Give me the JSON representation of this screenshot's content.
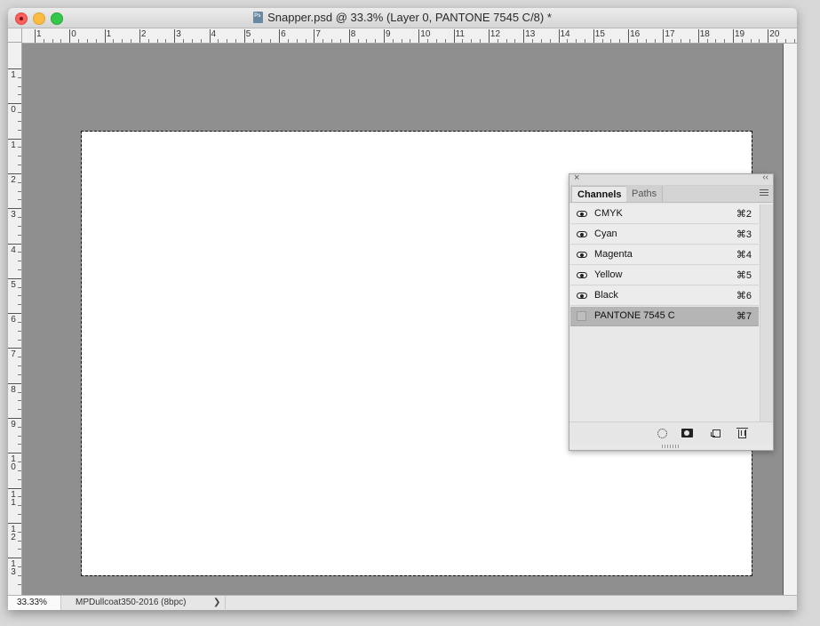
{
  "window": {
    "title": "Snapper.psd @ 33.3% (Layer 0, PANTONE 7545 C/8) *",
    "doc_icon": "photoshop-doc-icon"
  },
  "rulers": {
    "horizontal": [
      "1",
      "0",
      "1",
      "2",
      "3",
      "4",
      "5",
      "6",
      "7",
      "8",
      "9",
      "10",
      "11",
      "12",
      "13",
      "14",
      "15",
      "16",
      "17",
      "18",
      "19",
      "20"
    ],
    "vertical": [
      "1",
      "0",
      "1",
      "2",
      "3",
      "4",
      "5",
      "6",
      "7",
      "8",
      "9",
      "10",
      "11",
      "12",
      "13"
    ]
  },
  "status": {
    "zoom": "33.33%",
    "profile": "MPDullcoat350-2016 (8bpc)",
    "arrow": "❯"
  },
  "panel": {
    "close_glyph": "×",
    "collapse_glyph": "‹‹",
    "tabs": [
      {
        "label": "Channels",
        "active": true
      },
      {
        "label": "Paths",
        "active": false
      }
    ],
    "channels": [
      {
        "name": "CMYK",
        "shortcut": "⌘2",
        "visible": true,
        "selected": false
      },
      {
        "name": "Cyan",
        "shortcut": "⌘3",
        "visible": true,
        "selected": false
      },
      {
        "name": "Magenta",
        "shortcut": "⌘4",
        "visible": true,
        "selected": false
      },
      {
        "name": "Yellow",
        "shortcut": "⌘5",
        "visible": true,
        "selected": false
      },
      {
        "name": "Black",
        "shortcut": "⌘6",
        "visible": true,
        "selected": false
      },
      {
        "name": "PANTONE 7545 C",
        "shortcut": "⌘7",
        "visible": false,
        "selected": true
      }
    ],
    "footer_icons": [
      "load-selection-icon",
      "save-selection-mask-icon",
      "new-channel-icon",
      "trash-icon"
    ]
  },
  "colors": {
    "pasteboard": "#8f8f8f",
    "document": "#ffffff",
    "selected_row": "#b5b5b5"
  }
}
